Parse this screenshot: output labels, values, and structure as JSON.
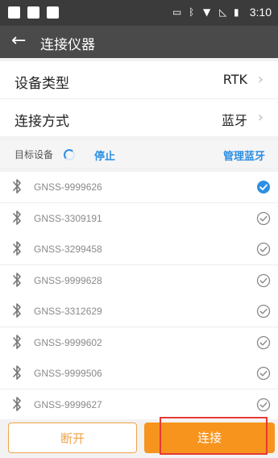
{
  "status_bar": {
    "time": "3:10",
    "icons": [
      "cast-icon",
      "bluetooth-icon",
      "wifi-icon",
      "no-signal-icon",
      "battery-icon"
    ]
  },
  "app_bar": {
    "title": "连接仪器",
    "back_icon": "arrow-left-icon"
  },
  "settings": [
    {
      "label": "设备类型",
      "value": "RTK"
    },
    {
      "label": "连接方式",
      "value": "蓝牙"
    }
  ],
  "target": {
    "label": "目标设备",
    "stop": "停止",
    "manage": "管理蓝牙"
  },
  "devices": [
    {
      "name": "GNSS-9999626",
      "selected": true
    },
    {
      "name": "GNSS-3309191",
      "selected": false
    },
    {
      "name": "GNSS-3299458",
      "selected": false
    },
    {
      "name": "GNSS-9999628",
      "selected": false
    },
    {
      "name": "GNSS-3312629",
      "selected": false
    },
    {
      "name": "GNSS-9999602",
      "selected": false
    },
    {
      "name": "GNSS-9999506",
      "selected": false
    },
    {
      "name": "GNSS-9999627",
      "selected": false
    }
  ],
  "buttons": {
    "disconnect": "断开",
    "connect": "连接"
  },
  "colors": {
    "accent": "#f7941d",
    "link": "#2d8fe3",
    "selected_check": "#2d8fe3",
    "highlight": "#e53935"
  }
}
